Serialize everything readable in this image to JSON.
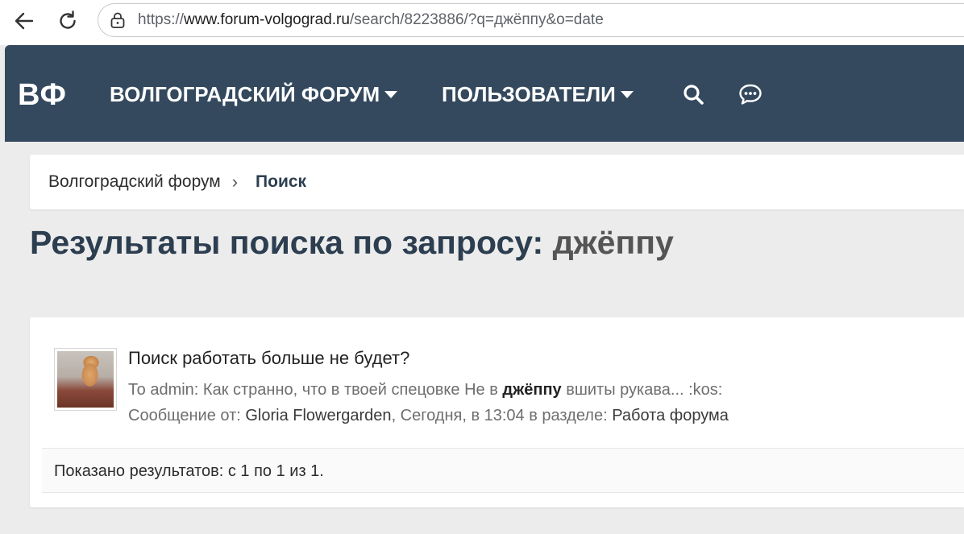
{
  "browser": {
    "back_icon": "arrow-left-icon",
    "reload_icon": "reload-icon",
    "lock_icon": "lock-icon",
    "url": {
      "scheme": "https://",
      "host": "www.forum-volgograd.ru",
      "path": "/search/8223886/?q=джёппу&o=date"
    }
  },
  "header": {
    "logo": "ВФ",
    "nav": [
      {
        "label": "ВОЛГОГРАДСКИЙ ФОРУМ"
      },
      {
        "label": "ПОЛЬЗОВАТЕЛИ"
      }
    ],
    "icons": [
      "search-icon",
      "chat-icon"
    ]
  },
  "breadcrumb": {
    "items": [
      "Волгоградский форум",
      "Поиск"
    ],
    "separator": "›"
  },
  "title": {
    "prefix": "Результаты поиска по запросу: ",
    "query": "джёппу"
  },
  "results": [
    {
      "title": "Поиск работать больше не будет?",
      "snippet_before": "То admin: Как странно, что в твоей спецовке Не в ",
      "snippet_highlight": "джёппу",
      "snippet_after": " вшиты рукава... :kos:",
      "meta_label": "Сообщение от: ",
      "author": "Gloria Flowergarden",
      "meta_mid": ", Сегодня, в 13:04 в разделе: ",
      "section": "Работа форума"
    }
  ],
  "footer": {
    "summary": "Показано результатов: с 1 по 1 из 1."
  },
  "colors": {
    "header_bg": "#34495e",
    "page_bg": "#ececec",
    "title": "#2c3e50"
  }
}
